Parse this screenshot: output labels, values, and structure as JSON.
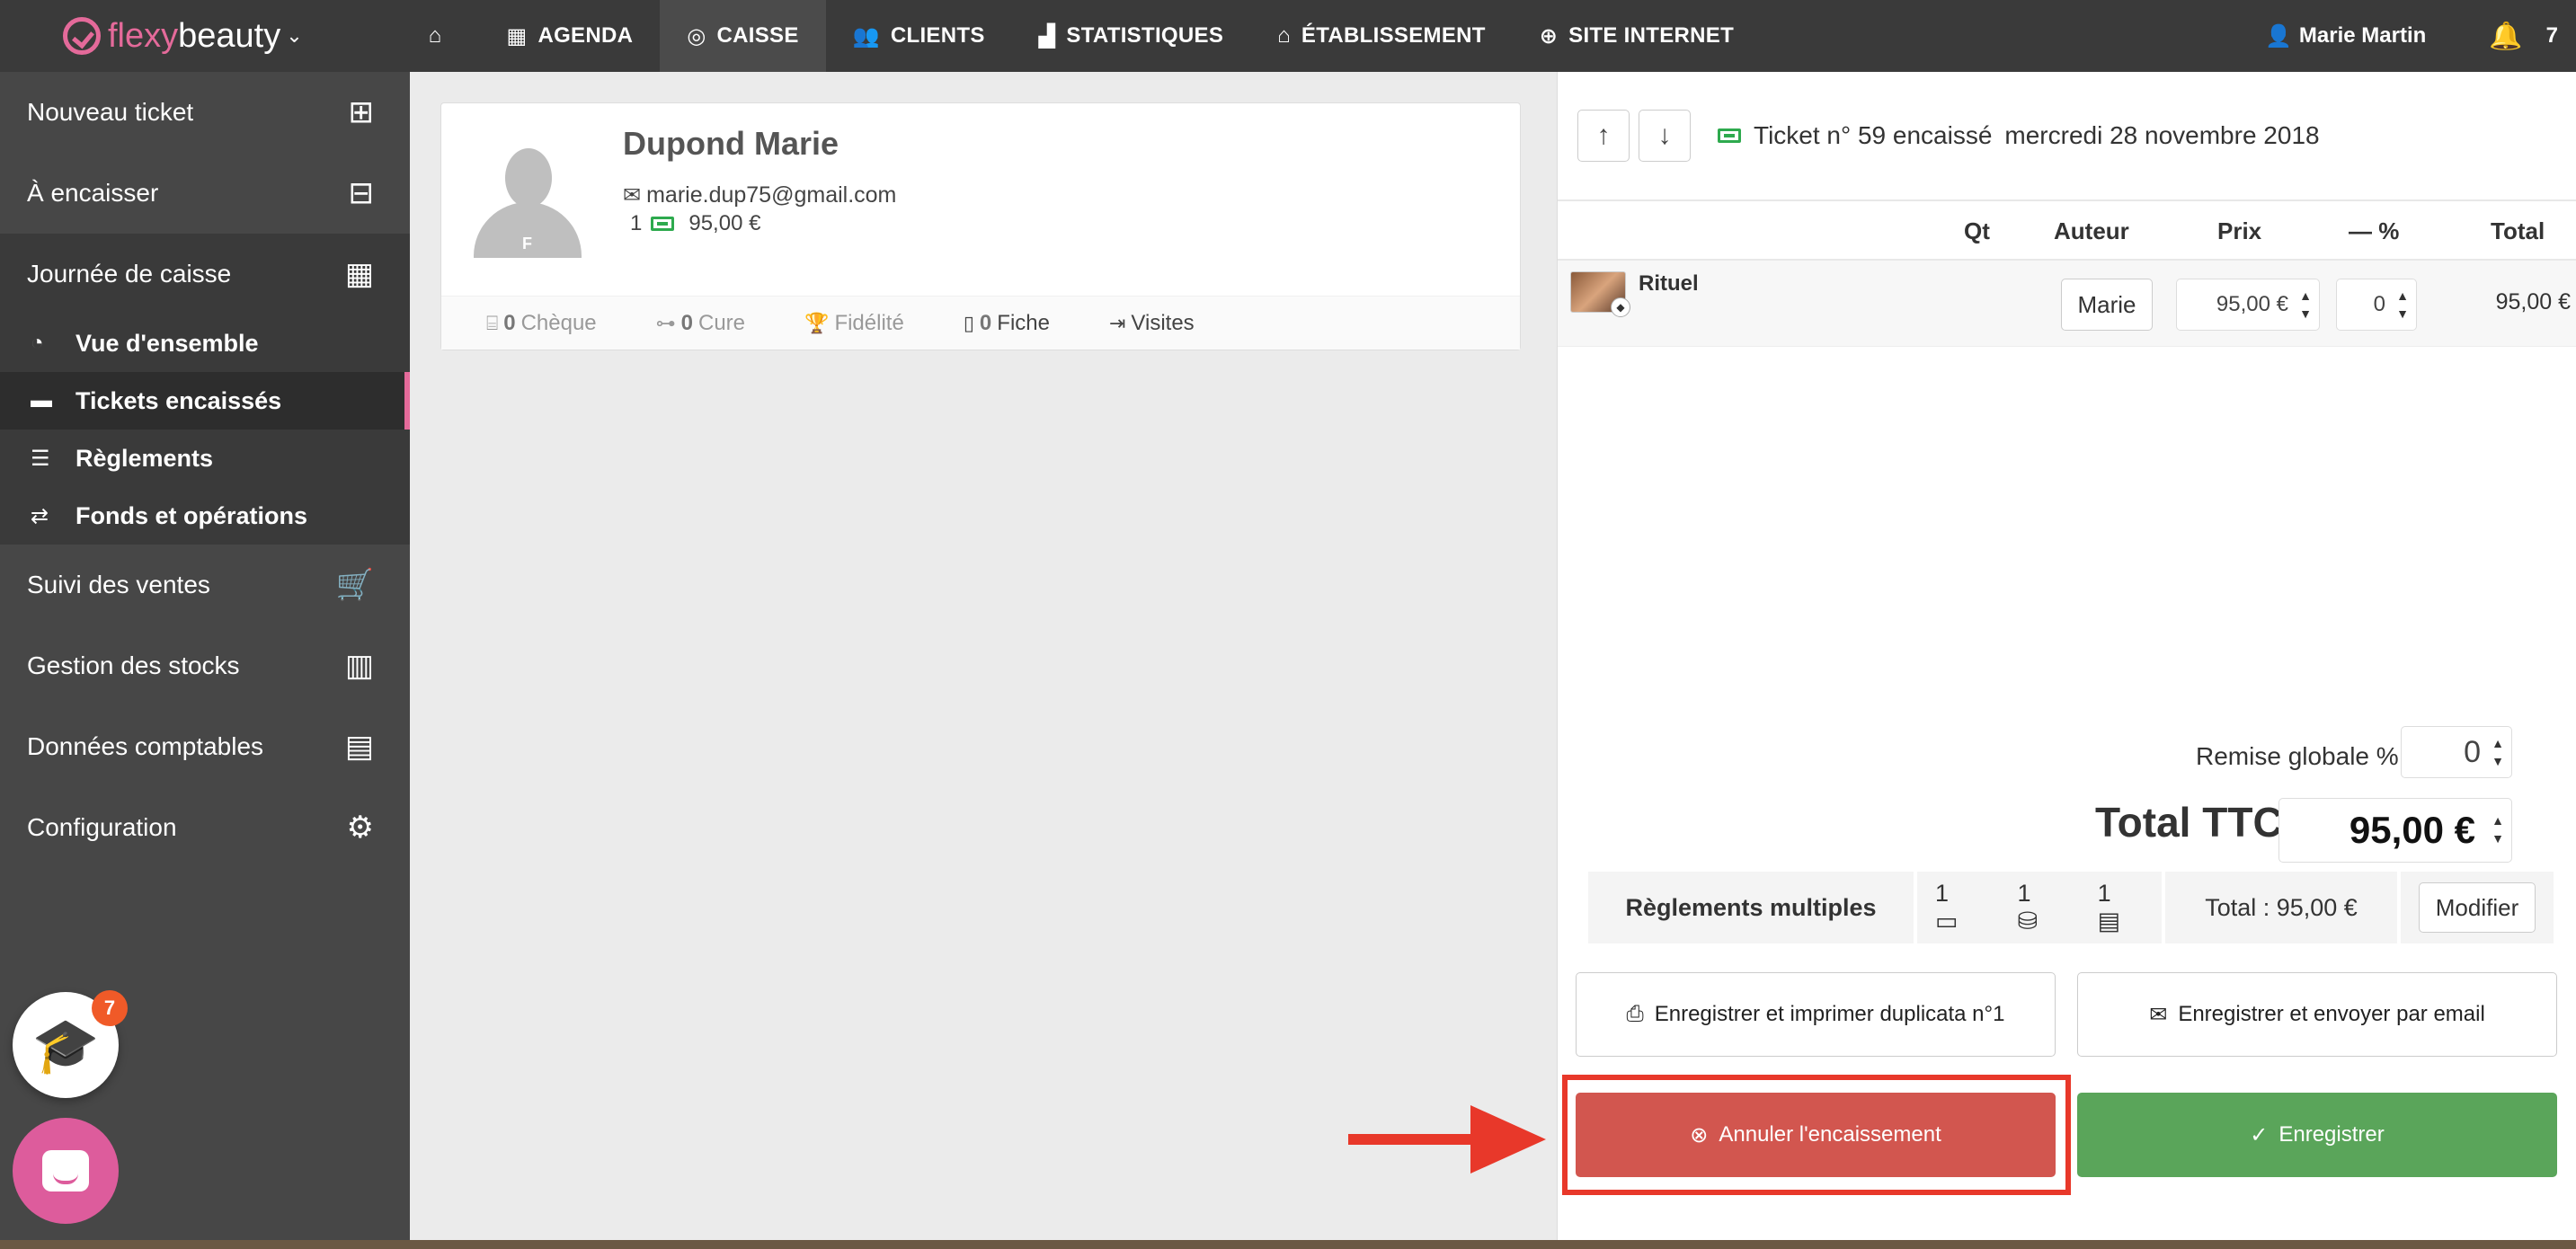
{
  "app": {
    "logo_part1": "flexy",
    "logo_part2": "beauty",
    "logo_caret": "⌄"
  },
  "nav": {
    "items": [
      {
        "label": "",
        "icon": "home-icon"
      },
      {
        "label": "AGENDA",
        "icon": "calendar-icon"
      },
      {
        "label": "CAISSE",
        "icon": "coins-icon"
      },
      {
        "label": "CLIENTS",
        "icon": "users-icon"
      },
      {
        "label": "STATISTIQUES",
        "icon": "chart-icon"
      },
      {
        "label": "ÉTABLISSEMENT",
        "icon": "store-icon"
      },
      {
        "label": "SITE INTERNET",
        "icon": "globe-icon"
      }
    ],
    "active": "CAISSE",
    "user_name": "Marie Martin",
    "notif_count": "7"
  },
  "sidebar": {
    "items": [
      {
        "label": "Nouveau ticket",
        "icon": "new-ticket-icon"
      },
      {
        "label": "À encaisser",
        "icon": "ticket-pause-icon"
      },
      {
        "label": "Journée de caisse",
        "icon": "calendar-euro-icon"
      }
    ],
    "sub_items": [
      {
        "label": "Vue d'ensemble",
        "icon": "pie-chart-icon"
      },
      {
        "label": "Tickets encaissés",
        "icon": "ticket-icon"
      },
      {
        "label": "Règlements",
        "icon": "list-icon"
      },
      {
        "label": "Fonds et opérations",
        "icon": "exchange-icon"
      }
    ],
    "items_after": [
      {
        "label": "Suivi des ventes",
        "icon": "cart-icon"
      },
      {
        "label": "Gestion des stocks",
        "icon": "barcode-icon"
      },
      {
        "label": "Données comptables",
        "icon": "calculator-icon"
      },
      {
        "label": "Configuration",
        "icon": "gears-icon"
      }
    ],
    "edu_badge": "7"
  },
  "client": {
    "name": "Dupond Marie",
    "avatar_letter": "F",
    "email": "marie.dup75@gmail.com",
    "ticket_count": "1",
    "ticket_amount": "95,00 €",
    "tabs": [
      {
        "count": "0",
        "label": "Chèque"
      },
      {
        "count": "0",
        "label": "Cure"
      },
      {
        "count": "",
        "label": "Fidélité"
      },
      {
        "count": "0",
        "label": "Fiche"
      },
      {
        "count": "",
        "label": "Visites"
      }
    ]
  },
  "ticket": {
    "number_label": "Ticket n° 59 encaissé",
    "date": "mercredi 28 novembre 2018",
    "columns": {
      "qt": "Qt",
      "auteur": "Auteur",
      "prix": "Prix",
      "pct": "— %",
      "total": "Total"
    },
    "rows": [
      {
        "name": "Rituel",
        "auteur": "Marie",
        "prix": "95,00 €",
        "pct": "0",
        "total": "95,00 €"
      }
    ],
    "remise_label": "Remise globale %",
    "remise_value": "0",
    "total_label": "Total TTC",
    "total_value": "95,00 €",
    "reglements_label": "Règlements multiples",
    "reg_counts": [
      "1",
      "1",
      "1"
    ],
    "reg_total": "Total : 95,00 €",
    "modifier": "Modifier",
    "btn_print": "Enregistrer et imprimer duplicata n°1",
    "btn_email": "Enregistrer et envoyer par email",
    "btn_cancel": "Annuler l'encaissement",
    "btn_save": "Enregistrer"
  },
  "colors": {
    "brand_pink": "#e46a9a",
    "cancel_red": "#d2564f",
    "save_green": "#5aa55a",
    "annotation_red": "#e8382a"
  }
}
